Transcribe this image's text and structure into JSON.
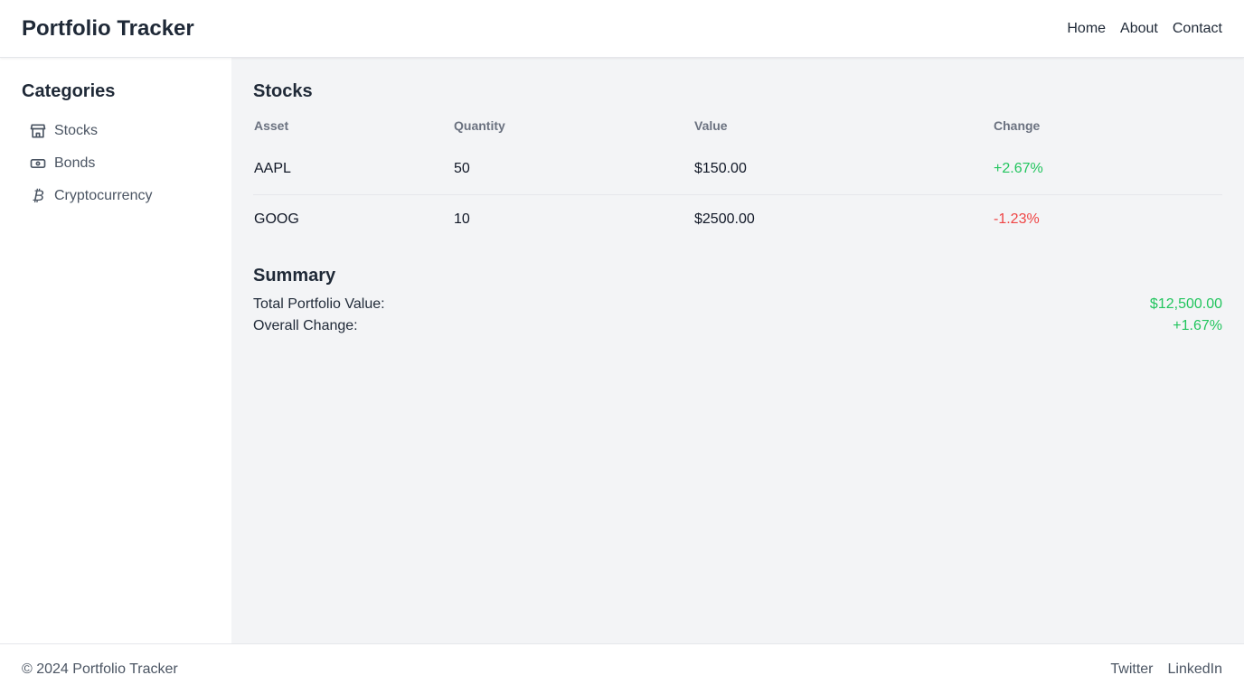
{
  "header": {
    "title": "Portfolio Tracker",
    "nav": [
      {
        "label": "Home"
      },
      {
        "label": "About"
      },
      {
        "label": "Contact"
      }
    ]
  },
  "sidebar": {
    "title": "Categories",
    "items": [
      {
        "label": "Stocks",
        "icon": "store-icon"
      },
      {
        "label": "Bonds",
        "icon": "banknote-icon"
      },
      {
        "label": "Cryptocurrency",
        "icon": "bitcoin-icon"
      }
    ]
  },
  "main": {
    "section_title": "Stocks",
    "table": {
      "columns": [
        "Asset",
        "Quantity",
        "Value",
        "Change"
      ],
      "rows": [
        {
          "asset": "AAPL",
          "quantity": "50",
          "value": "$150.00",
          "change": "+2.67%",
          "trend": "up"
        },
        {
          "asset": "GOOG",
          "quantity": "10",
          "value": "$2500.00",
          "change": "-1.23%",
          "trend": "down"
        }
      ]
    },
    "summary": {
      "title": "Summary",
      "total_label": "Total Portfolio Value:",
      "total_value": "$12,500.00",
      "change_label": "Overall Change:",
      "change_value": "+1.67%"
    }
  },
  "footer": {
    "copyright": "© 2024 Portfolio Tracker",
    "links": [
      {
        "label": "Twitter"
      },
      {
        "label": "LinkedIn"
      }
    ]
  },
  "colors": {
    "positive": "#22c55e",
    "negative": "#ef4444",
    "main_background": "#f3f4f6",
    "text_primary": "#1f2937",
    "text_muted": "#6b7280"
  }
}
